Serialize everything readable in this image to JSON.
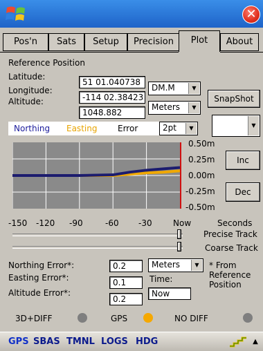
{
  "tabs": [
    {
      "label": "Pos'n"
    },
    {
      "label": "Sats"
    },
    {
      "label": "Setup"
    },
    {
      "label": "Precision"
    },
    {
      "label": "Plot"
    },
    {
      "label": "About"
    }
  ],
  "reference": {
    "heading": "Reference Position",
    "latitude_label": "Latitude:",
    "latitude_value": "51 01.040738",
    "longitude_label": "Longitude:",
    "longitude_value": "-114 02.38423",
    "altitude_label": "Altitude:",
    "altitude_value": "1048.882",
    "format_select": "DM.M",
    "units_select": "Meters",
    "snapshot_label": "SnapShot"
  },
  "legend": {
    "northing": "Northing",
    "easting": "Easting",
    "error": "Error",
    "point_select": "2pt",
    "extra_select": ""
  },
  "plot": {
    "y_ticks": [
      "0.50m",
      "0.25m",
      "0.00m",
      "-0.25m",
      "-0.50m"
    ],
    "x_ticks": [
      "-150",
      "-120",
      "-90",
      "-60",
      "-30",
      "Now"
    ],
    "x_unit": "Seconds",
    "inc_label": "Inc",
    "dec_label": "Dec",
    "precise_track": "Precise Track",
    "coarse_track": "Coarse Track",
    "precise_slider_level": 0.98,
    "coarse_slider_level": 0.98
  },
  "errors": {
    "northing_label": "Northing Error*:",
    "northing_value": "0.2",
    "easting_label": "Easting Error*:",
    "easting_value": "0.1",
    "altitude_label": "Altitude Error*:",
    "altitude_value": "0.2",
    "units_select": "Meters",
    "note": "* From Reference Position",
    "time_label": "Time:",
    "time_value": "Now"
  },
  "status": {
    "mode1": "3D+DIFF",
    "mode2": "GPS",
    "mode3": "NO DIFF",
    "colors": {
      "gray": "#7f7f7f",
      "orange": "#f5a800"
    }
  },
  "taskbar": {
    "items": [
      "GPS",
      "SBAS",
      "TMNL",
      "LOGS",
      "HDG"
    ]
  },
  "chart_data": {
    "type": "line",
    "x": [
      -150,
      -120,
      -90,
      -60,
      -45,
      -30,
      -15,
      0
    ],
    "series": [
      {
        "name": "Northing",
        "values": [
          0.0,
          0.0,
          0.0,
          0.01,
          0.05,
          0.08,
          0.1,
          0.12
        ]
      },
      {
        "name": "Easting",
        "values": [
          0.0,
          0.0,
          0.0,
          0.0,
          0.02,
          0.04,
          0.05,
          0.07
        ]
      }
    ],
    "xlim": [
      -150,
      0
    ],
    "ylim": [
      -0.5,
      0.5
    ],
    "colors": {
      "Northing": "#1c1c6e",
      "Easting": "#f0a800"
    }
  }
}
